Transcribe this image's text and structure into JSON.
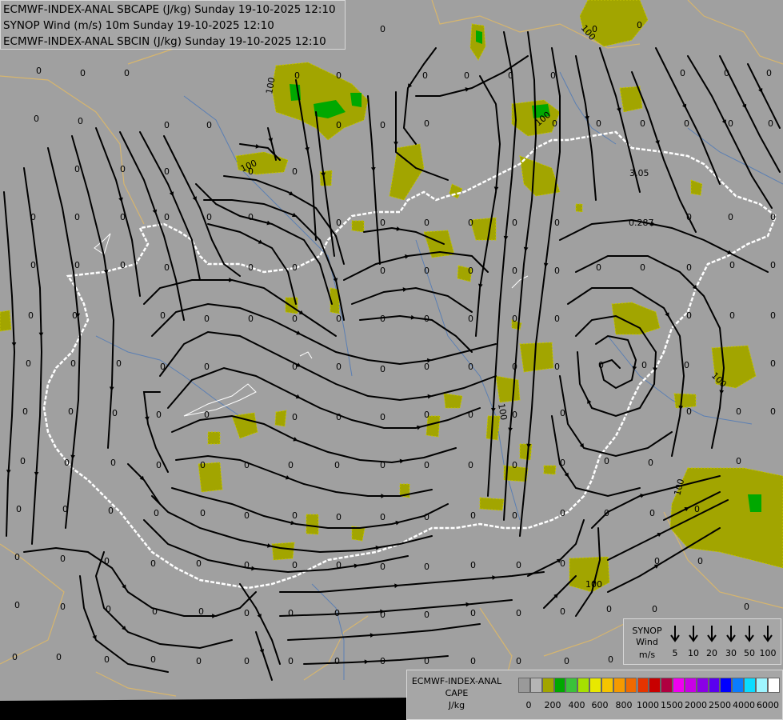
{
  "titles": {
    "line1": "ECMWF-INDEX-ANAL SBCAPE (J/kg) Sunday 19-10-2025 12:10",
    "line2": "SYNOP Wind (m/s) 10m Sunday 19-10-2025 12:10",
    "line3": "ECMWF-INDEX-ANAL SBCIN (J/kg) Sunday 19-10-2025 12:10"
  },
  "synop_legend": {
    "title_line1": "SYNOP",
    "title_line2": "Wind",
    "title_line3": "m/s",
    "speeds": [
      "5",
      "10",
      "20",
      "30",
      "50",
      "100"
    ]
  },
  "cape_legend": {
    "title_line1": "ECMWF-INDEX-ANAL",
    "title_line2": "CAPE",
    "title_line3": "J/kg",
    "ticks": [
      "0",
      "200",
      "400",
      "600",
      "800",
      "1000",
      "1500",
      "2000",
      "2500",
      "4000",
      "6000"
    ],
    "colors": [
      "#9a9a9a",
      "#b5b5b5",
      "#a2a500",
      "#00a800",
      "#3ac23a",
      "#a6e000",
      "#e8e800",
      "#f5c400",
      "#f59a00",
      "#f06a00",
      "#e53400",
      "#c80000",
      "#b00040",
      "#f000f0",
      "#c800e6",
      "#8a00e6",
      "#5a00f0",
      "#0000ff",
      "#0a7cff",
      "#0adcff",
      "#9ff5ff",
      "#ffffff"
    ]
  },
  "map": {
    "background_color": "#a0a0a0",
    "cape_fill_color": "#a2a500",
    "cape_high_color": "#00a800",
    "border_color": "#ffffff",
    "region_line_color": "#d6b56e",
    "river_color": "#5b7fb3",
    "contour_labels": [
      "100",
      "100",
      "100",
      "100",
      "100",
      "100",
      "100",
      "100"
    ],
    "cin_labels": [
      "3.05",
      "0.287"
    ],
    "zero_label": "0"
  }
}
